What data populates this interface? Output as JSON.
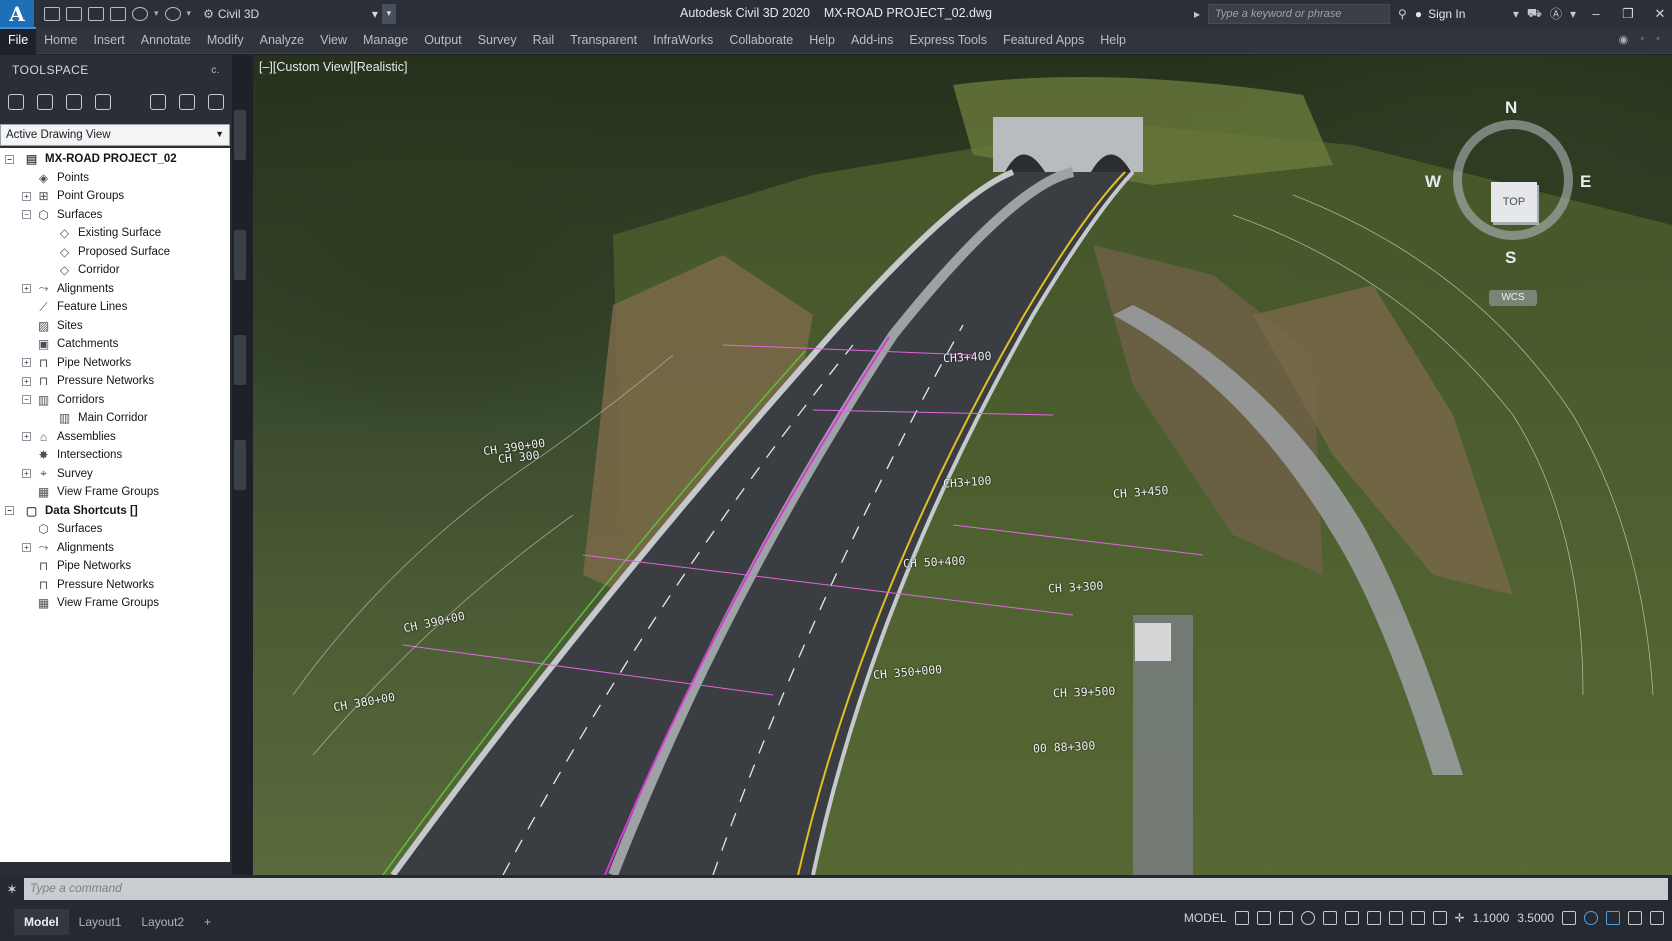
{
  "app": {
    "logo": "A",
    "workspace": "Civil 3D",
    "title": "Autodesk Civil 3D 2020",
    "drawing": "MX-ROAD PROJECT_02.dwg",
    "search_placeholder": "Type a keyword or phrase",
    "sign_in": "Sign In"
  },
  "ribbon": {
    "tabs": [
      "File",
      "Home",
      "Insert",
      "Annotate",
      "Modify",
      "Analyze",
      "View",
      "Manage",
      "Output",
      "Survey",
      "Rail",
      "Transparent",
      "InfraWorks",
      "Collaborate",
      "Help",
      "Add-ins",
      "Express Tools",
      "Featured Apps",
      "Help"
    ],
    "active": "File"
  },
  "toolspace": {
    "title": "TOOLSPACE",
    "menu": "c.",
    "view_select": "Active Drawing View",
    "tree": [
      {
        "label": "MX-ROAD PROJECT_02",
        "level": 0,
        "expander": "-",
        "icon": "drawing-icon"
      },
      {
        "label": "Points",
        "level": 1,
        "expander": "",
        "icon": "points-icon"
      },
      {
        "label": "Point Groups",
        "level": 1,
        "expander": "+",
        "icon": "point-groups-icon"
      },
      {
        "label": "Surfaces",
        "level": 1,
        "expander": "-",
        "icon": "surfaces-icon"
      },
      {
        "label": "Existing Surface",
        "level": 2,
        "expander": "",
        "icon": "surface-icon"
      },
      {
        "label": "Proposed Surface",
        "level": 2,
        "expander": "",
        "icon": "surface-icon"
      },
      {
        "label": "Corridor",
        "level": 2,
        "expander": "",
        "icon": "surface-icon"
      },
      {
        "label": "Alignments",
        "level": 1,
        "expander": "+",
        "icon": "alignments-icon"
      },
      {
        "label": "Feature Lines",
        "level": 1,
        "expander": "",
        "icon": "feature-lines-icon"
      },
      {
        "label": "Sites",
        "level": 1,
        "expander": "",
        "icon": "sites-icon"
      },
      {
        "label": "Catchments",
        "level": 1,
        "expander": "",
        "icon": "catchments-icon"
      },
      {
        "label": "Pipe Networks",
        "level": 1,
        "expander": "+",
        "icon": "pipe-networks-icon"
      },
      {
        "label": "Pressure Networks",
        "level": 1,
        "expander": "+",
        "icon": "pressure-networks-icon"
      },
      {
        "label": "Corridors",
        "level": 1,
        "expander": "-",
        "icon": "corridors-icon"
      },
      {
        "label": "Main Corridor",
        "level": 2,
        "expander": "",
        "icon": "corridor-icon"
      },
      {
        "label": "Assemblies",
        "level": 1,
        "expander": "+",
        "icon": "assemblies-icon"
      },
      {
        "label": "Intersections",
        "level": 1,
        "expander": "",
        "icon": "intersections-icon"
      },
      {
        "label": "Survey",
        "level": 1,
        "expander": "+",
        "icon": "survey-icon"
      },
      {
        "label": "View Frame Groups",
        "level": 1,
        "expander": "",
        "icon": "view-frame-groups-icon"
      },
      {
        "label": "Data Shortcuts []",
        "level": 0,
        "expander": "-",
        "icon": "data-shortcuts-icon"
      },
      {
        "label": "Surfaces",
        "level": 1,
        "expander": "",
        "icon": "surfaces-icon"
      },
      {
        "label": "Alignments",
        "level": 1,
        "expander": "+",
        "icon": "alignments-icon"
      },
      {
        "label": "Pipe Networks",
        "level": 1,
        "expander": "",
        "icon": "pipe-networks-icon"
      },
      {
        "label": "Pressure Networks",
        "level": 1,
        "expander": "",
        "icon": "pressure-networks-icon"
      },
      {
        "label": "View Frame Groups",
        "level": 1,
        "expander": "",
        "icon": "view-frame-groups-icon"
      }
    ]
  },
  "viewport": {
    "label": "[–][Custom View][Realistic]",
    "stations": [
      "CH 390+00",
      "CH 380+00",
      "CH 390+00",
      "CH3+100",
      "CH 50+400",
      "CH 350+000",
      "CH3+400",
      "CH 300",
      "CH 39+500",
      "CH 3+300",
      "CH 3+450",
      "00 88+300"
    ],
    "viewcube": {
      "n": "N",
      "s": "S",
      "e": "E",
      "w": "W",
      "face": "TOP",
      "wcs": "WCS"
    }
  },
  "command": {
    "placeholder": "Type a command"
  },
  "status": {
    "layouts": [
      "Model",
      "Layout1",
      "Layout2"
    ],
    "active_layout": "Model",
    "add": "+",
    "mode": "MODEL",
    "scale1": "1.1000",
    "scale2": "3.5000"
  },
  "colors": {
    "accent": "#1d6fb8",
    "alignment": "#d63ad6",
    "edge": "#e0c020",
    "breakline": "#58c23a"
  }
}
